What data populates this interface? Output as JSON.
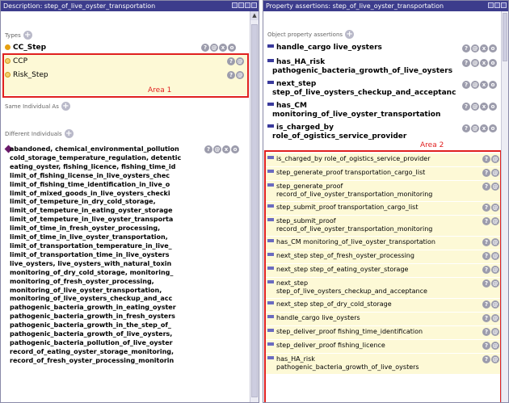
{
  "left": {
    "title": "Description: step_of_live_oyster_transportation",
    "types_label": "Types",
    "types": [
      "CC_Step",
      "CCP",
      "Risk_Step"
    ],
    "same_label": "Same Individual As",
    "different_label": "Different Individuals",
    "area1_label": "Area 1",
    "different_individuals": [
      "abandoned, chemical_environmental_pollution",
      "cold_storage_temperature_regulation, detentic",
      "eating_oyster, fishing_licence, fishing_time_id",
      "limit_of_fishing_license_in_live_oysters_chec",
      "limit_of_fishing_time_identification_in_live_o",
      "limit_of_mixed_goods_in_live_oysters_checki",
      "limit_of_tempeture_in_dry_cold_storage,",
      "limit_of_tempeture_in_eating_oyster_storage",
      "limit_of_tempeture_in_live_oyster_transporta",
      "limit_of_time_in_fresh_oyster_processing,",
      "limit_of_time_in_live_oyster_transportation,",
      "limit_of_transportation_temperature_in_live_",
      " limit_of_transportation_time_in_live_oysters",
      "live_oysters, live_oysters_with_natural_toxin",
      "monitoring_of_dry_cold_storage, monitoring_",
      "monitoring_of_fresh_oyster_processing,",
      "monitoring_of_live_oyster_transportation,",
      "monitoring_of_live_oysters_checkup_and_acc",
      "pathogenic_bacteria_growth_in_eating_oyster",
      "pathogenic_bacteria_growth_in_fresh_oysters",
      "pathogenic_bacteria_growth_in_the_step_of_",
      "pathogenic_bacteria_growth_of_live_oysters,",
      "pathogenic_bacteria_pollution_of_live_oyster",
      "record_of_eating_oyster_storage_monitoring,",
      "record_of_fresh_oyster_processing_monitorin"
    ]
  },
  "right": {
    "title": "Property assertions: step_of_live_oyster_transportation",
    "obj_label": "Object property assertions",
    "area2_label": "Area 2",
    "bold_assertions": [
      {
        "l1": "handle_cargo  live_oysters"
      },
      {
        "l1": "has_HA_risk",
        "l2": "pathogenic_bacteria_growth_of_live_oysters"
      },
      {
        "l1": "next_step",
        "l2": "step_of_live_oysters_checkup_and_acceptanc"
      },
      {
        "l1": "has_CM",
        "l2": "monitoring_of_live_oyster_transportation"
      },
      {
        "l1": "is_charged_by",
        "l2": "role_of_ogistics_service_provider"
      }
    ],
    "inferred_assertions": [
      {
        "l1": "is_charged_by  role_of_ogistics_service_provider"
      },
      {
        "l1": "step_generate_proof  transportation_cargo_list"
      },
      {
        "l1": "step_generate_proof",
        "l2": "record_of_live_oyster_transportation_monitoring"
      },
      {
        "l1": "step_submit_proof  transportation_cargo_list"
      },
      {
        "l1": "step_submit_proof",
        "l2": "record_of_live_oyster_transportation_monitoring"
      },
      {
        "l1": "has_CM  monitoring_of_live_oyster_transportation"
      },
      {
        "l1": "next_step  step_of_fresh_oyster_processing"
      },
      {
        "l1": "next_step  step_of_eating_oyster_storage"
      },
      {
        "l1": "next_step",
        "l2": "step_of_live_oysters_checkup_and_acceptance"
      },
      {
        "l1": "next_step  step_of_dry_cold_storage"
      },
      {
        "l1": "handle_cargo  live_oysters"
      },
      {
        "l1": "step_deliver_proof  fishing_time_identification"
      },
      {
        "l1": "step_deliver_proof  fishing_licence"
      },
      {
        "l1": "has_HA_risk",
        "l2": "pathogenic_bacteria_growth_of_live_oysters"
      }
    ]
  },
  "icons": {
    "help": "?",
    "edit": "@",
    "remove": "x",
    "confirm": "o",
    "add": "+",
    "scroll_up": "▲"
  }
}
